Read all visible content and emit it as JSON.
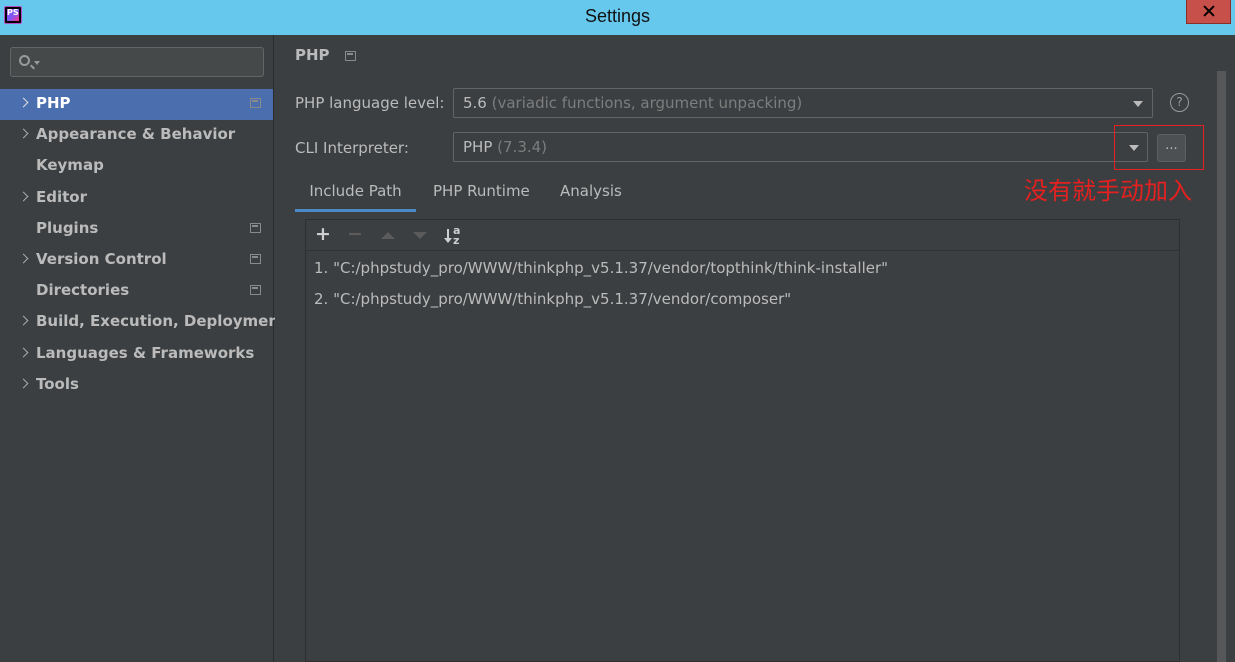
{
  "window": {
    "title": "Settings",
    "app_icon_text": "PS"
  },
  "sidebar": {
    "search": {
      "value": "",
      "placeholder": ""
    },
    "items": [
      {
        "label": "PHP",
        "expandable": true,
        "project_icon": true,
        "selected": true
      },
      {
        "label": "Appearance & Behavior",
        "expandable": true,
        "project_icon": false
      },
      {
        "label": "Keymap",
        "expandable": false,
        "project_icon": false
      },
      {
        "label": "Editor",
        "expandable": true,
        "project_icon": false
      },
      {
        "label": "Plugins",
        "expandable": false,
        "project_icon": true
      },
      {
        "label": "Version Control",
        "expandable": true,
        "project_icon": true
      },
      {
        "label": "Directories",
        "expandable": false,
        "project_icon": true
      },
      {
        "label": "Build, Execution, Deployment",
        "expandable": true,
        "project_icon": false
      },
      {
        "label": "Languages & Frameworks",
        "expandable": true,
        "project_icon": false
      },
      {
        "label": "Tools",
        "expandable": true,
        "project_icon": false
      }
    ]
  },
  "main": {
    "title": "PHP",
    "language_level": {
      "label": "PHP language level:",
      "value": "5.6",
      "hint": "(variadic functions, argument unpacking)"
    },
    "cli_interpreter": {
      "label": "CLI Interpreter:",
      "value": "PHP",
      "hint": "(7.3.4)",
      "browse_label": "..."
    },
    "help_label": "?",
    "annotation": "没有就手动加入",
    "tabs": [
      {
        "label": "Include Path",
        "active": true
      },
      {
        "label": "PHP Runtime",
        "active": false
      },
      {
        "label": "Analysis",
        "active": false
      }
    ],
    "toolbar": {
      "add": "+",
      "remove": "−",
      "sort_a": "a",
      "sort_z": "z"
    },
    "include_paths": [
      "1. \"C:/phpstudy_pro/WWW/thinkphp_v5.1.37/vendor/topthink/think-installer\"",
      "2. \"C:/phpstudy_pro/WWW/thinkphp_v5.1.37/vendor/composer\""
    ]
  },
  "colors": {
    "titlebar": "#65c8ec",
    "background": "#3c3f41",
    "selection": "#4b6eaf",
    "annotation": "#e52020",
    "tab_underline": "#4a88c7"
  }
}
